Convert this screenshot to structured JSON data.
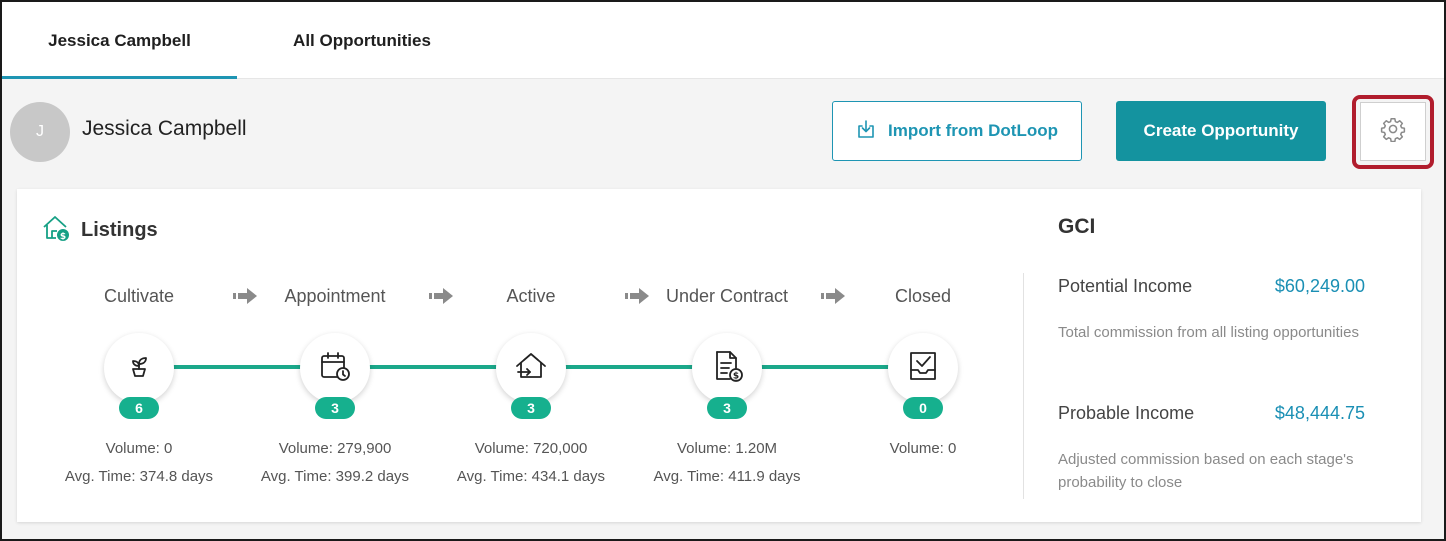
{
  "tabs": [
    {
      "label": "Jessica Campbell",
      "active": true
    },
    {
      "label": "All Opportunities",
      "active": false
    }
  ],
  "agent": {
    "initial": "J",
    "name": "Jessica Campbell"
  },
  "actions": {
    "import_label": "Import from DotLoop",
    "create_label": "Create Opportunity",
    "settings_icon": "gear-icon"
  },
  "listings": {
    "title": "Listings",
    "icon": "house-dollar-icon",
    "stages": [
      {
        "label": "Cultivate",
        "icon": "plant-icon",
        "count": "6",
        "volume": "Volume: 0",
        "avg_time": "Avg. Time: 374.8 days"
      },
      {
        "label": "Appointment",
        "icon": "calendar-clock-icon",
        "count": "3",
        "volume": "Volume: 279,900",
        "avg_time": "Avg. Time: 399.2 days"
      },
      {
        "label": "Active",
        "icon": "house-arrow-icon",
        "count": "3",
        "volume": "Volume: 720,000",
        "avg_time": "Avg. Time: 434.1 days"
      },
      {
        "label": "Under Contract",
        "icon": "document-dollar-icon",
        "count": "3",
        "volume": "Volume: 1.20M",
        "avg_time": "Avg. Time: 411.9 days"
      },
      {
        "label": "Closed",
        "icon": "inbox-check-icon",
        "count": "0",
        "volume": "Volume: 0",
        "avg_time": ""
      }
    ]
  },
  "gci": {
    "title": "GCI",
    "potential": {
      "label": "Potential Income",
      "value": "$60,249.00",
      "description": "Total commission from all listing opportunities"
    },
    "probable": {
      "label": "Probable Income",
      "value": "$48,444.75",
      "description": "Adjusted commission based on each stage's probability to close"
    }
  },
  "colors": {
    "accent": "#1e95b3",
    "primary_button": "#14939f",
    "stage_green": "#16b08e",
    "highlight_border": "#b11d2d"
  }
}
